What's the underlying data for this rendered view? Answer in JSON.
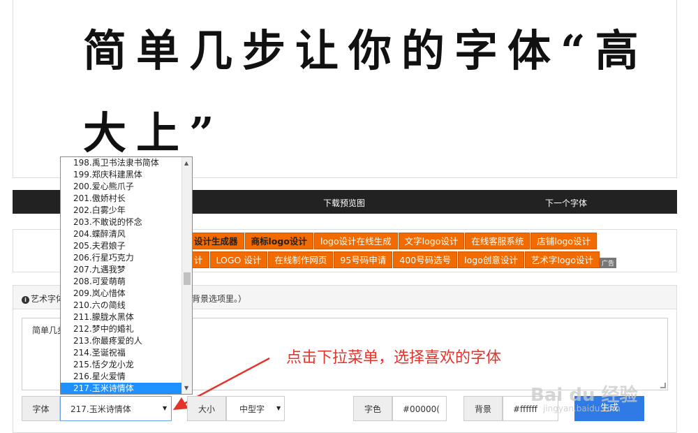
{
  "preview": {
    "line1": "简单几步让你的字体“高",
    "line2": "大上”"
  },
  "toolbar": {
    "download_label": "下载预览图",
    "next_label": "下一个字体"
  },
  "ads": {
    "row1": [
      "设计生成器",
      "商标logo设计",
      "logo设计在线生成",
      "文字logo设计",
      "在线客服系统",
      "店铺logo设计"
    ],
    "row2": [
      "计",
      "LOGO 设计",
      "在线制作网页",
      "95号码申请",
      "400号码选号",
      "logo创意设计",
      "艺术字logo设计"
    ],
    "tag": "广告"
  },
  "panel": {
    "info_left": "艺术字体",
    "info_right": "背景选项里。）",
    "textarea_value": "简单几步"
  },
  "font_dropdown": {
    "items": [
      "198.禹卫书法隶书简体",
      "199.郑庆科建黑体",
      "200.爱心熊爪子",
      "201.傲娇村长",
      "202.白雾少年",
      "203.不敢说的怀念",
      "204.蝶醉清风",
      "205.夫君娘子",
      "206.行星巧克力",
      "207.九遇我梦",
      "208.可爱萌萌",
      "209.岚心惜体",
      "210.六の简线",
      "211.朦胧水黑体",
      "212.梦中的婚礼",
      "213.你最疼爱的人",
      "214.圣诞祝福",
      "215.恬夕龙小龙",
      "216.星火爱情",
      "217.玉米诗情体"
    ],
    "selected_index": 19
  },
  "form": {
    "font_label": "字体",
    "font_value": "217.玉米诗情体",
    "size_label": "大小",
    "size_value": "中型字",
    "color_label": "字色",
    "color_value": "#00000(",
    "bg_label": "背景",
    "bg_value": "#ffffff",
    "generate_label": "生成"
  },
  "annotation": {
    "hint": "点击下拉菜单，选择喜欢的字体"
  },
  "watermark": {
    "main": "Bai du 经验",
    "sub": "jingyan.baidu.com"
  },
  "colors": {
    "accent": "#2f7ae5",
    "ad_orange": "#f26b00",
    "hint_red": "#e5322b",
    "selected_blue": "#1e90ff"
  }
}
